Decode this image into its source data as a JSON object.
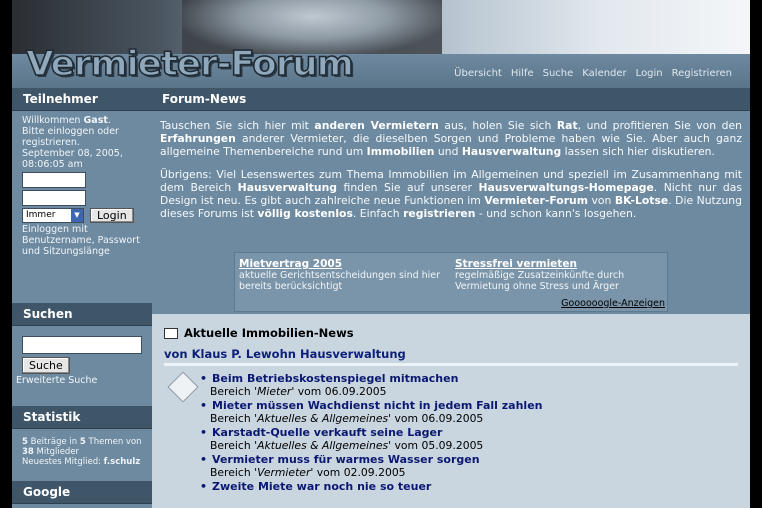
{
  "header": {
    "logo": "Vermieter-Forum",
    "nav": [
      "Übersicht",
      "Hilfe",
      "Suche",
      "Kalender",
      "Login",
      "Registrieren"
    ]
  },
  "sidebar": {
    "members": {
      "title": "Teilnehmer",
      "welcome_prefix": "Willkommen",
      "user": "Gast",
      "line2": "Bitte einloggen oder registrieren.",
      "date": "September 08, 2005, 08:06:05 am",
      "duration_option": "Immer",
      "login_button": "Login",
      "hint": "Einloggen mit Benutzername, Passwort und Sitzungslänge"
    },
    "search": {
      "title": "Suchen",
      "button": "Suche",
      "advanced": "Erweiterte Suche"
    },
    "stats": {
      "title": "Statistik",
      "posts": "5",
      "posts_label": "Beiträge in",
      "topics": "5",
      "topics_label": "Themen von",
      "members": "38",
      "members_label": "Mitglieder",
      "newest_label": "Neuestes Mitglied:",
      "newest": "f.schulz"
    },
    "google": {
      "title": "Google"
    }
  },
  "main": {
    "title": "Forum-News",
    "intro": {
      "p1_a": "Tauschen Sie sich hier mit ",
      "p1_b": "anderen Vermietern",
      "p1_c": " aus, holen Sie sich ",
      "p1_d": "Rat",
      "p1_e": ", und profitieren Sie von den ",
      "p1_f": "Erfahrungen",
      "p1_g": " anderer Vermieter, die dieselben Sorgen und Probleme haben wie Sie. Aber auch ganz allgemeine Themenbereiche rund um ",
      "p1_h": "Immobilien",
      "p1_i": " und ",
      "p1_j": "Hausverwaltung",
      "p1_k": " lassen sich hier diskutieren.",
      "p2_a": "Übrigens: Viel Lesenswertes zum Thema Immobilien im Allgemeinen und speziell im Zusammenhang mit dem Bereich ",
      "p2_b": "Hausverwaltung",
      "p2_c": " finden Sie auf unserer ",
      "p2_d": "Hausverwaltungs-Homepage",
      "p2_e": ". Nicht nur das Design ist neu. Es gibt auch zahlreiche neue Funktionen im ",
      "p2_f": "Vermieter-Forum",
      "p2_g": " von ",
      "p2_h": "BK-Lotse",
      "p2_i": ". Die Nutzung dieses Forums ist ",
      "p2_j": "völlig kostenlos",
      "p2_k": ". Einfach ",
      "p2_l": "registrieren",
      "p2_m": " - und schon kann's losgehen."
    },
    "ads": [
      {
        "title": "Mietvertrag 2005",
        "text": "aktuelle Gerichtsentscheidungen sind hier bereits berücksichtigt"
      },
      {
        "title": "Stressfrei vermieten",
        "text": "regelmäßige Zusatzeinkünfte durch Vermietung ohne Stress und Ärger"
      }
    ],
    "ads_google": "Goooooogle-Anzeigen",
    "news": {
      "title": "Aktuelle Immobilien-News",
      "source": "von Klaus P. Lewohn Hausverwaltung",
      "items": [
        {
          "title": "Beim Betriebskostenspiegel mitmachen",
          "prefix": "Bereich ",
          "category": "'Mieter'",
          "date": " vom 06.09.2005"
        },
        {
          "title": "Mieter müssen Wachdienst nicht in jedem Fall zahlen",
          "prefix": "Bereich ",
          "category": "'Aktuelles & Allgemeines'",
          "date": " vom 06.09.2005"
        },
        {
          "title": "Karstadt-Quelle verkauft seine Lager",
          "prefix": "Bereich ",
          "category": "'Aktuelles & Allgemeines'",
          "date": " vom 05.09.2005"
        },
        {
          "title": "Vermieter muss für warmes Wasser sorgen",
          "prefix": "Bereich ",
          "category": "'Vermieter'",
          "date": " vom 02.09.2005"
        },
        {
          "title": "Zweite Miete war noch nie so teuer",
          "prefix": "",
          "category": "",
          "date": ""
        }
      ]
    }
  }
}
